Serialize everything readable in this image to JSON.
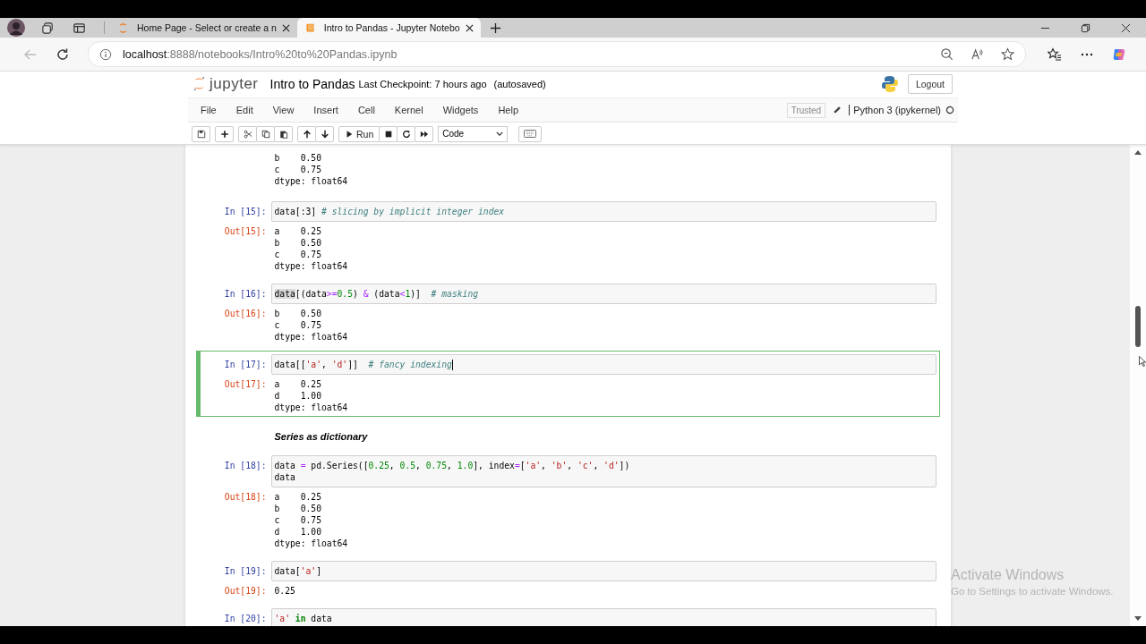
{
  "browser": {
    "tabs": [
      {
        "title": "Home Page - Select or create a n",
        "selected": false
      },
      {
        "title": "Intro to Pandas - Jupyter Notebo",
        "selected": true
      }
    ],
    "url_host": "localhost",
    "url_rest": ":8888/notebooks/Intro%20to%20Pandas.ipynb"
  },
  "header": {
    "logo_text": "jupyter",
    "title": "Intro to Pandas",
    "checkpoint": "Last Checkpoint: 7 hours ago",
    "autosave": "(autosaved)",
    "logout": "Logout",
    "menu": [
      "File",
      "Edit",
      "View",
      "Insert",
      "Cell",
      "Kernel",
      "Widgets",
      "Help"
    ],
    "trusted": "Trusted",
    "kernel": "Python 3 (ipykernel)",
    "run": "Run",
    "cell_type": "Code"
  },
  "cells": [
    {
      "kind": "output_only",
      "output": [
        "b    0.50",
        "c    0.75",
        "dtype: float64"
      ]
    },
    {
      "kind": "code",
      "selected": false,
      "in_prompt": "In [15]:",
      "source": [
        [
          {
            "t": "data[:3] ",
            "kind": "plain"
          },
          {
            "t": "# slicing by implicit integer index",
            "kind": "comment"
          }
        ]
      ],
      "out_prompt": "Out[15]:",
      "output": [
        "a    0.25",
        "b    0.50",
        "c    0.75",
        "dtype: float64"
      ]
    },
    {
      "kind": "code",
      "selected": false,
      "in_prompt": "In [16]:",
      "source": [
        [
          {
            "t": "data",
            "kind": "match"
          },
          {
            "t": "[(data",
            "kind": "plain"
          },
          {
            "t": ">=",
            "kind": "op"
          },
          {
            "t": "0.5",
            "kind": "num"
          },
          {
            "t": ") ",
            "kind": "plain"
          },
          {
            "t": "&",
            "kind": "op"
          },
          {
            "t": " (data",
            "kind": "plain"
          },
          {
            "t": "<",
            "kind": "op"
          },
          {
            "t": "1",
            "kind": "num"
          },
          {
            "t": ")]  ",
            "kind": "plain"
          },
          {
            "t": "# masking",
            "kind": "comment"
          }
        ]
      ],
      "out_prompt": "Out[16]:",
      "output": [
        "b    0.50",
        "c    0.75",
        "dtype: float64"
      ]
    },
    {
      "kind": "code",
      "selected": true,
      "in_prompt": "In [17]:",
      "source": [
        [
          {
            "t": "data[[",
            "kind": "plain"
          },
          {
            "t": "'a'",
            "kind": "str"
          },
          {
            "t": ", ",
            "kind": "plain"
          },
          {
            "t": "'d'",
            "kind": "str"
          },
          {
            "t": "]]  ",
            "kind": "plain"
          },
          {
            "t": "# fancy indexing",
            "kind": "comment"
          }
        ]
      ],
      "out_prompt": "Out[17]:",
      "output": [
        "a    0.25",
        "d    1.00",
        "dtype: float64"
      ]
    },
    {
      "kind": "markdown",
      "text": "Series as dictionary"
    },
    {
      "kind": "code",
      "selected": false,
      "in_prompt": "In [18]:",
      "source": [
        [
          {
            "t": "data ",
            "kind": "plain"
          },
          {
            "t": "=",
            "kind": "op"
          },
          {
            "t": " pd.Series([",
            "kind": "plain"
          },
          {
            "t": "0.25",
            "kind": "num"
          },
          {
            "t": ", ",
            "kind": "plain"
          },
          {
            "t": "0.5",
            "kind": "num"
          },
          {
            "t": ", ",
            "kind": "plain"
          },
          {
            "t": "0.75",
            "kind": "num"
          },
          {
            "t": ", ",
            "kind": "plain"
          },
          {
            "t": "1.0",
            "kind": "num"
          },
          {
            "t": "], index",
            "kind": "plain"
          },
          {
            "t": "=",
            "kind": "op"
          },
          {
            "t": "[",
            "kind": "plain"
          },
          {
            "t": "'a'",
            "kind": "str"
          },
          {
            "t": ", ",
            "kind": "plain"
          },
          {
            "t": "'b'",
            "kind": "str"
          },
          {
            "t": ", ",
            "kind": "plain"
          },
          {
            "t": "'c'",
            "kind": "str"
          },
          {
            "t": ", ",
            "kind": "plain"
          },
          {
            "t": "'d'",
            "kind": "str"
          },
          {
            "t": "])",
            "kind": "plain"
          }
        ],
        [
          {
            "t": "data",
            "kind": "plain"
          }
        ]
      ],
      "out_prompt": "Out[18]:",
      "output": [
        "a    0.25",
        "b    0.50",
        "c    0.75",
        "d    1.00",
        "dtype: float64"
      ]
    },
    {
      "kind": "code",
      "selected": false,
      "in_prompt": "In [19]:",
      "source": [
        [
          {
            "t": "data[",
            "kind": "plain"
          },
          {
            "t": "'a'",
            "kind": "str"
          },
          {
            "t": "]",
            "kind": "plain"
          }
        ]
      ],
      "out_prompt": "Out[19]:",
      "output": [
        "0.25"
      ]
    },
    {
      "kind": "code",
      "selected": false,
      "in_prompt": "In [20]:",
      "source": [
        [
          {
            "t": "'a'",
            "kind": "str"
          },
          {
            "t": " in",
            "kind": "kw"
          },
          {
            "t": " data",
            "kind": "plain"
          }
        ]
      ]
    }
  ],
  "activation": {
    "title": "Activate Windows",
    "text": "Go to Settings to activate Windows."
  }
}
